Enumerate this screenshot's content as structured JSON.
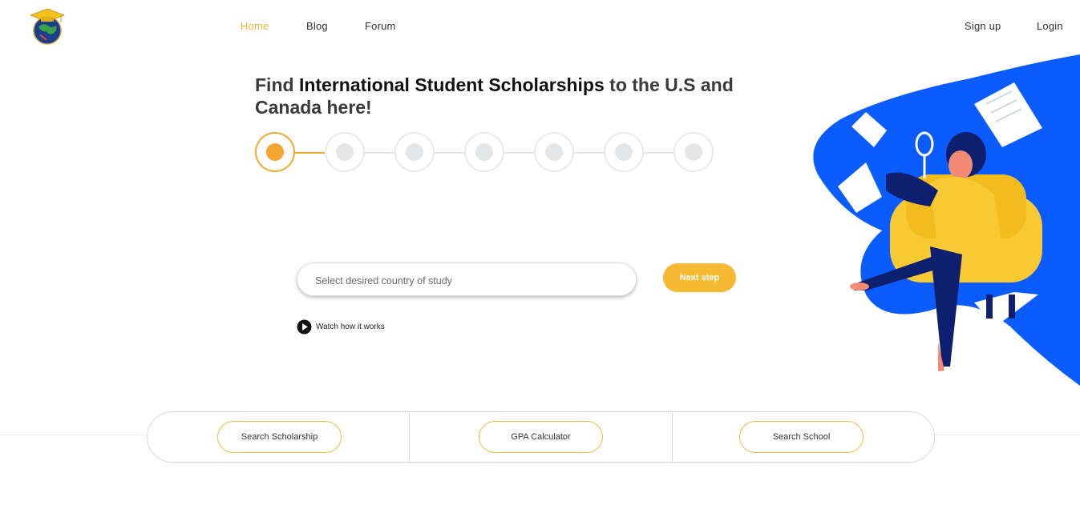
{
  "header": {
    "logo_icon": "graduation-cap-globe-icon",
    "nav": [
      {
        "label": "Home",
        "active": true
      },
      {
        "label": "Blog",
        "active": false
      },
      {
        "label": "Forum",
        "active": false
      }
    ],
    "sign_up": "Sign up",
    "login": "Login"
  },
  "hero": {
    "headline_part1": "Find ",
    "headline_strong": "International Student Scholarships",
    "headline_part2": " to the U.S and Canada here!",
    "steps_total": 7,
    "current_step": 1,
    "search_placeholder": "Select desired country of study",
    "next_label": "Next step",
    "watch_label": "Watch how it works",
    "illustration_icon": "student-reading-armchair-illustration"
  },
  "tools": [
    {
      "label": "Search Scholarship"
    },
    {
      "label": "GPA Calculator"
    },
    {
      "label": "Search School"
    }
  ],
  "colors": {
    "accent": "#f5b335",
    "accent_button": "#f5b932",
    "illustration_blue": "#0b5cff",
    "illustration_yellow": "#f7c932",
    "illustration_navy": "#0d1f6e"
  }
}
